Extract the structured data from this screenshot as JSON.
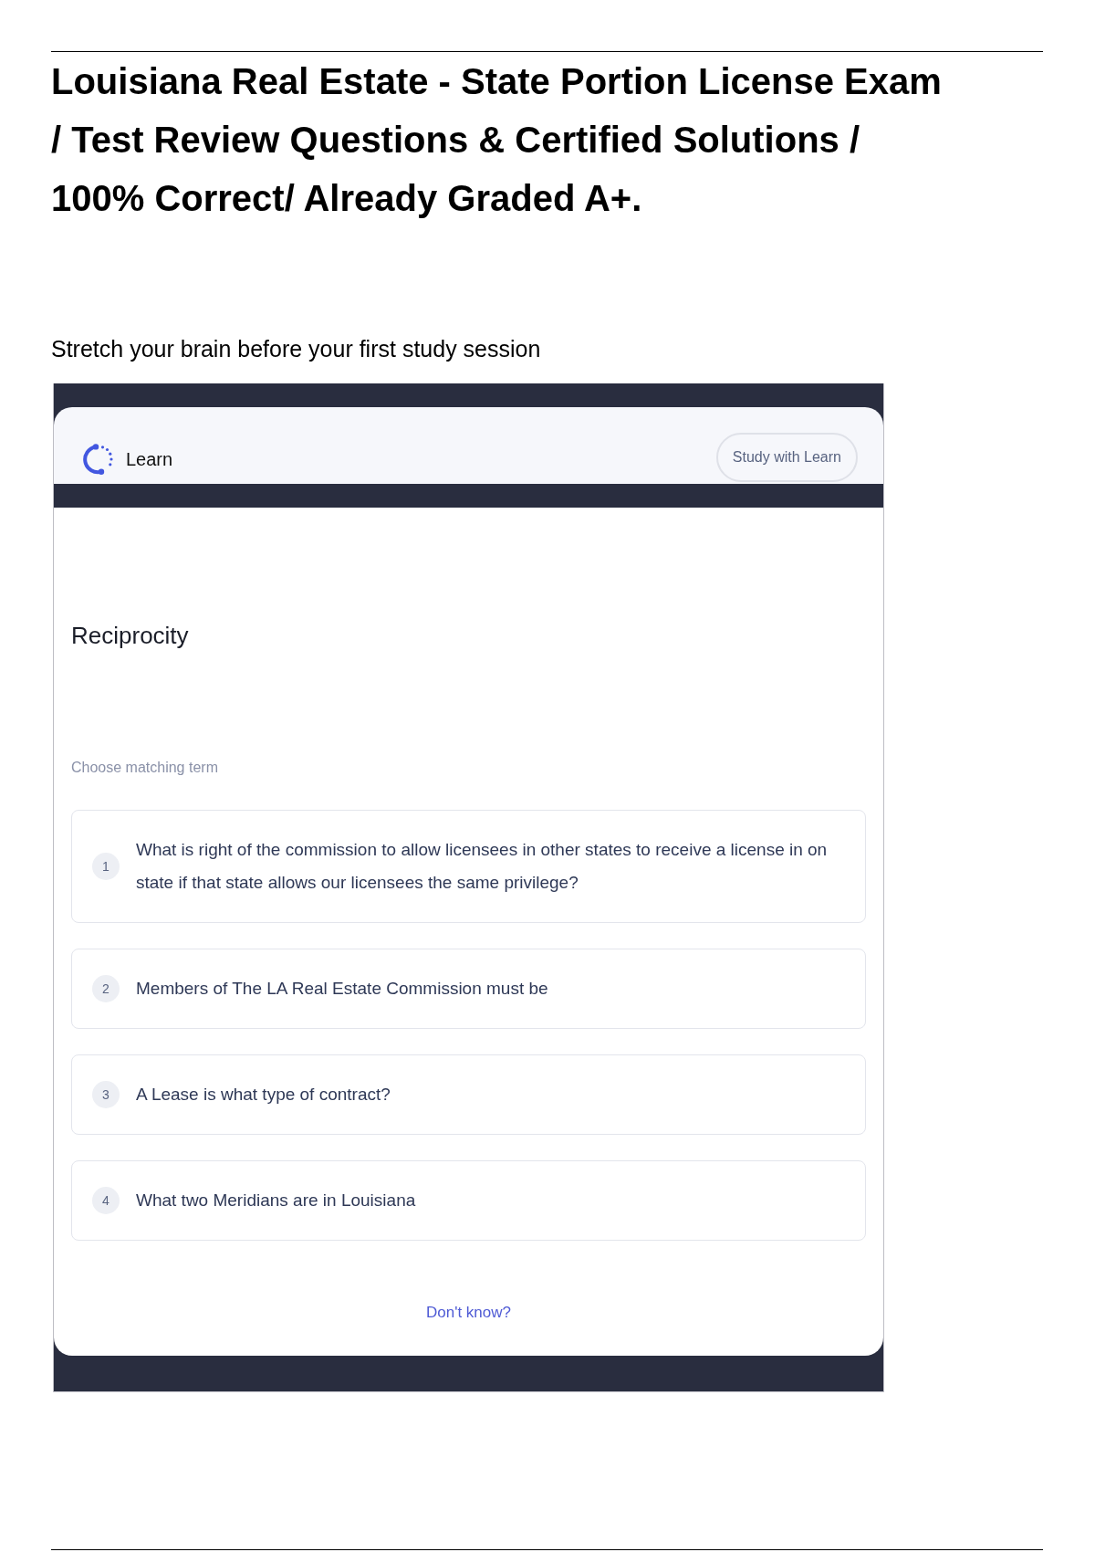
{
  "document": {
    "title": "Louisiana Real Estate - State Portion License Exam / Test Review Questions & Certified Solutions / 100% Correct/ Already Graded A+.",
    "intro": "Stretch your brain before your first study session"
  },
  "learn_card": {
    "header": {
      "brand": "Learn",
      "button": "Study with Learn"
    },
    "term": "Reciprocity",
    "prompt": "Choose matching term",
    "options": [
      {
        "number": "1",
        "text": "What is right of the commission to allow licensees in other states to receive a license in on state if that state allows our licensees the same privilege?",
        "selected": false
      },
      {
        "number": "2",
        "text": "Members of The LA Real Estate Commission must be",
        "selected": false
      },
      {
        "number": "3",
        "text": "A Lease is what type of contract?",
        "selected": false
      },
      {
        "number": "4",
        "text": "What two Meridians are in Louisiana",
        "selected": false
      }
    ],
    "link": "Don't know?"
  }
}
